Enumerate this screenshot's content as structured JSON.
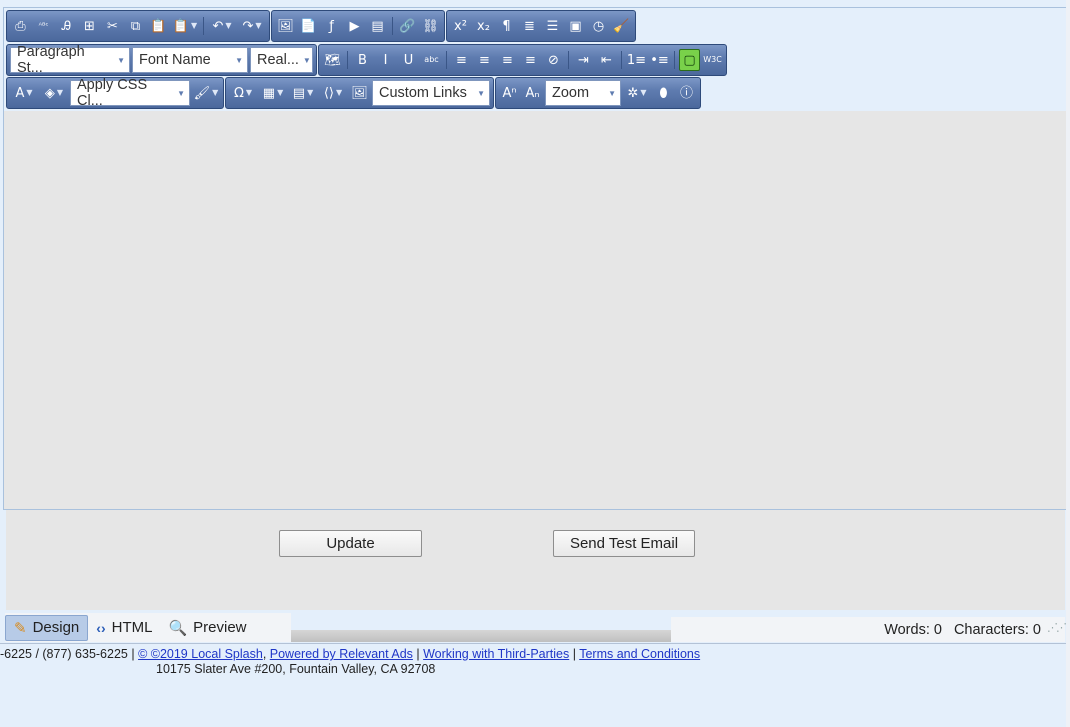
{
  "toolbar": {
    "row1": [
      {
        "name": "print-icon",
        "glyph": "⎙"
      },
      {
        "name": "spellcheck-icon",
        "glyph": "ᴬᴮᶜ"
      },
      {
        "name": "find-replace-icon",
        "glyph": "Ꭿ"
      },
      {
        "name": "select-all-icon",
        "glyph": "⊞"
      },
      {
        "name": "cut-icon",
        "glyph": "✂"
      },
      {
        "name": "copy-icon",
        "glyph": "⧉"
      },
      {
        "name": "paste-icon",
        "glyph": "📋"
      },
      {
        "name": "paste-options-icon",
        "glyph": "📋",
        "dropdown": true
      },
      {
        "name": "undo-icon",
        "glyph": "↶",
        "dropdown": true
      },
      {
        "name": "redo-icon",
        "glyph": "↷",
        "dropdown": true
      },
      {
        "name": "image-manager-icon",
        "glyph": "🖼"
      },
      {
        "name": "document-manager-icon",
        "glyph": "📄"
      },
      {
        "name": "flash-manager-icon",
        "glyph": "ƒ"
      },
      {
        "name": "media-manager-icon",
        "glyph": "▶"
      },
      {
        "name": "template-manager-icon",
        "glyph": "▤"
      },
      {
        "name": "link-icon",
        "glyph": "🔗"
      },
      {
        "name": "unlink-icon",
        "glyph": "⛓"
      },
      {
        "name": "superscript-icon",
        "glyph": "x²"
      },
      {
        "name": "subscript-icon",
        "glyph": "x₂"
      },
      {
        "name": "paragraph-icon",
        "glyph": "¶"
      },
      {
        "name": "insert-symbol-icon",
        "glyph": "≣"
      },
      {
        "name": "horizontal-rule-icon",
        "glyph": "☰"
      },
      {
        "name": "form-element-icon",
        "glyph": "▣"
      },
      {
        "name": "insert-date-icon",
        "glyph": "◷"
      },
      {
        "name": "format-stripper-icon",
        "glyph": "🧹"
      }
    ],
    "row2": {
      "paragraph_style": "Paragraph St...",
      "font_name": "Font Name",
      "font_size": "Real...",
      "buttons": [
        {
          "name": "image-map-icon",
          "glyph": "🗺"
        },
        {
          "name": "bold-icon",
          "glyph": "B"
        },
        {
          "name": "italic-icon",
          "glyph": "I"
        },
        {
          "name": "underline-icon",
          "glyph": "U"
        },
        {
          "name": "strikethrough-icon",
          "glyph": "abc"
        },
        {
          "name": "align-left-icon",
          "glyph": "≡"
        },
        {
          "name": "align-center-icon",
          "glyph": "≡"
        },
        {
          "name": "align-right-icon",
          "glyph": "≡"
        },
        {
          "name": "justify-icon",
          "glyph": "≡"
        },
        {
          "name": "remove-alignment-icon",
          "glyph": "⊘"
        },
        {
          "name": "indent-icon",
          "glyph": "⇥"
        },
        {
          "name": "outdent-icon",
          "glyph": "⇤"
        },
        {
          "name": "numbered-list-icon",
          "glyph": "1≡"
        },
        {
          "name": "bulleted-list-icon",
          "glyph": "•≡"
        },
        {
          "name": "toggle-border-icon",
          "glyph": "▢",
          "active": true
        },
        {
          "name": "xhtml-validator-icon",
          "glyph": "W3C"
        }
      ]
    },
    "row3": {
      "css_class": "Apply CSS Cl...",
      "custom_links": "Custom Links",
      "zoom": "Zoom",
      "buttons_left": [
        {
          "name": "fore-color-icon",
          "glyph": "A",
          "dropdown": true
        },
        {
          "name": "back-color-icon",
          "glyph": "◈",
          "dropdown": true
        }
      ],
      "buttons_mid": [
        {
          "name": "format-painter-icon",
          "glyph": "🖌",
          "dropdown": true
        },
        {
          "name": "special-character-icon",
          "glyph": "Ω",
          "dropdown": true
        },
        {
          "name": "insert-table-icon",
          "glyph": "▦",
          "dropdown": true
        },
        {
          "name": "snippet-icon",
          "glyph": "▤",
          "dropdown": true
        },
        {
          "name": "custom-html-icon",
          "glyph": "⟨⟩",
          "dropdown": true
        },
        {
          "name": "insert-image-icon",
          "glyph": "🖼"
        }
      ],
      "buttons_after_links": [
        {
          "name": "font-size-increase-icon",
          "glyph": "Aⁿ"
        },
        {
          "name": "font-size-decrease-icon",
          "glyph": "Aₙ"
        }
      ],
      "buttons_right": [
        {
          "name": "module-manager-icon",
          "glyph": "✲",
          "dropdown": true
        },
        {
          "name": "track-changes-icon",
          "glyph": "⬮"
        },
        {
          "name": "about-icon",
          "glyph": "ⓘ"
        }
      ]
    }
  },
  "buttons": {
    "update": "Update",
    "send_test_email": "Send Test Email"
  },
  "mode_tabs": {
    "design": "Design",
    "html": "HTML",
    "preview": "Preview"
  },
  "stats": {
    "words": "Words: 0",
    "characters": "Characters: 0"
  },
  "footer": {
    "phone": "-6225 / (877) 635-6225 | ",
    "copyright": "© ©2019 Local Splash",
    "sep1": ", ",
    "powered_by": "Powered by Relevant Ads",
    "sep2": " | ",
    "third_parties": "Working with Third-Parties",
    "sep3": " | ",
    "terms": "Terms and Conditions",
    "address": "10175 Slater Ave #200, Fountain Valley, CA 92708"
  },
  "colors": {
    "toolbar_blue": "#5f7cb0",
    "page_bg": "#e4effb",
    "editor_bg": "#e6e6e6",
    "active_green": "#79d14a",
    "link_blue": "#1f36c7"
  }
}
